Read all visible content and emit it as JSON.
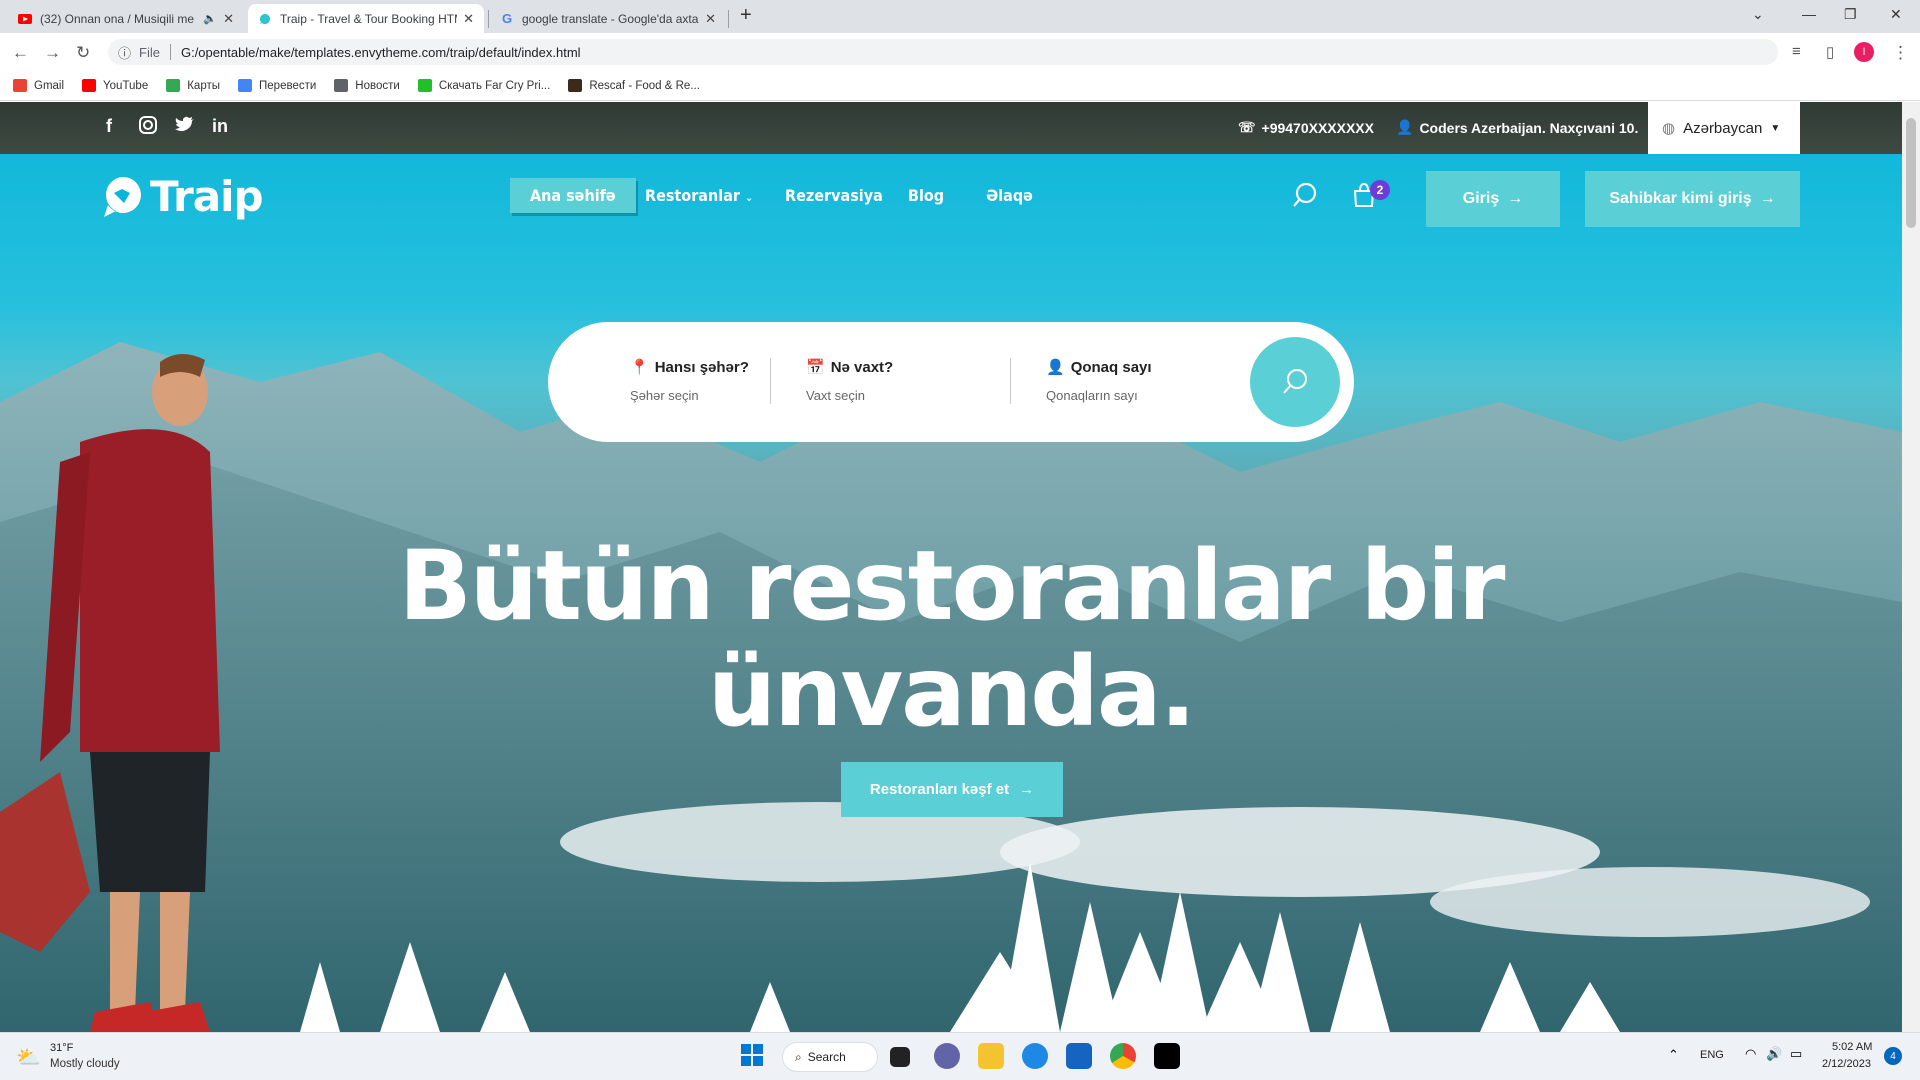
{
  "browser": {
    "tabs": [
      {
        "title": "(32) Onnan ona / Musiqili me",
        "icon": "youtube-icon"
      },
      {
        "title": "Traip - Travel & Tour Booking HTML",
        "icon": "traip-icon"
      },
      {
        "title": "google translate - Google'da axtar",
        "icon": "google-icon"
      }
    ],
    "url_label": "File",
    "url": "G:/opentable/make/templates.envytheme.com/traip/default/index.html",
    "profile_initial": "I",
    "bookmarks": [
      {
        "label": "Gmail",
        "color": "#ea4335"
      },
      {
        "label": "YouTube",
        "color": "#ff0000"
      },
      {
        "label": "Карты",
        "color": "#34a853"
      },
      {
        "label": "Перевести",
        "color": "#4285f4"
      },
      {
        "label": "Новости",
        "color": "#5f6368"
      },
      {
        "label": "Скачать Far Cry Pri...",
        "color": "#21c02a"
      },
      {
        "label": "Rescaf - Food & Re...",
        "color": "#3b2a1a"
      }
    ]
  },
  "site": {
    "topbar": {
      "phone": "+99470XXXXXXX",
      "address": "Coders Azerbaijan. Naxçıvani 10.",
      "language": "Azərbaycan"
    },
    "logo": "Traip",
    "nav": [
      "Ana səhifə",
      "Restoranlar",
      "Rezervasiya",
      "Blog",
      "Əlaqə"
    ],
    "cart_count": "2",
    "login": "Giriş",
    "owner_login": "Sahibkar kimi giriş",
    "search": {
      "city_title": "Hansı şəhər?",
      "city_sub": "Şəhər seçin",
      "time_title": "Nə vaxt?",
      "time_sub": "Vaxt seçin",
      "guests_title": "Qonaq sayı",
      "guests_sub": "Qonaqların sayı"
    },
    "headline_line1": "Bütün restoranlar bir",
    "headline_line2": "ünvanda.",
    "cta": "Restoranları kəşf et"
  },
  "taskbar": {
    "weather_temp": "31°F",
    "weather_desc": "Mostly cloudy",
    "search": "Search",
    "lang": "ENG",
    "time": "5:02 AM",
    "date": "2/12/2023",
    "notif": "4"
  },
  "colors": {
    "accent": "#5ad0d6",
    "sky": "#0bb5d9",
    "badge": "#6f3cd8"
  }
}
